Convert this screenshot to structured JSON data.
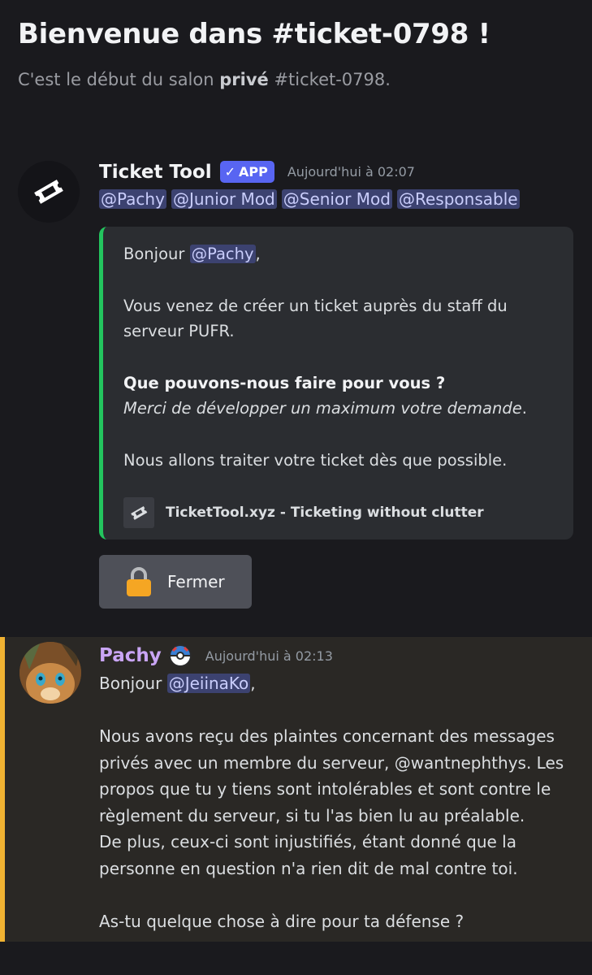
{
  "channel": {
    "welcome_title": "Bienvenue dans #ticket-0798 !",
    "sub_prefix": "C'est le début du salon ",
    "sub_bold": "privé",
    "sub_suffix": " #ticket-0798."
  },
  "bot_message": {
    "author": "Ticket Tool",
    "badge": "APP",
    "timestamp": "Aujourd'hui à 02:07",
    "mentions": [
      "@Pachy",
      "@Junior Mod",
      "@Senior Mod",
      "@Responsable"
    ],
    "embed": {
      "accent_color": "#23c55e",
      "greeting": "Bonjour ",
      "greeting_mention": "@Pachy",
      "greeting_end": ",",
      "line1": "Vous venez de créer un ticket auprès du staff du serveur PUFR.",
      "bold_question": "Que pouvons-nous faire pour vous ?",
      "italic_line": "Merci de développer un maximum votre demande",
      "italic_end": ".",
      "line3": "Nous allons traiter votre ticket dès que possible.",
      "footer_text": "TicketTool.xyz - Ticketing without clutter",
      "footer_icon": "ticket-icon"
    },
    "button": {
      "icon": "lock-icon",
      "label": "Fermer"
    }
  },
  "user_message": {
    "author": "Pachy",
    "author_color": "#c9a5f5",
    "badge_icon": "pokeball-icon",
    "timestamp": "Aujourd'hui à 02:13",
    "greeting": "Bonjour ",
    "greeting_mention": "@JeiinaKo",
    "greeting_end": ",",
    "p1_l1": "Nous avons reçu des plaintes concernant des messages",
    "p1_l2": "privés avec un membre du serveur, @wantnephthys. Les",
    "p1_l3": "propos que tu y tiens sont intolérables et sont contre le",
    "p1_l4": "règlement du serveur, si tu l'as bien lu au préalable.",
    "p1_l5": "De plus, ceux-ci sont injustifiés, étant donné que la",
    "p1_l6": "personne en question n'a rien dit de mal contre toi.",
    "question": "As-tu quelque chose à dire pour ta défense ?",
    "highlight_color": "#f0b232"
  }
}
